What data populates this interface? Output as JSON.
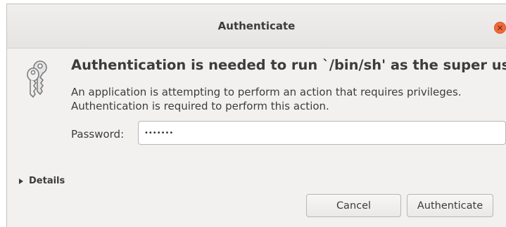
{
  "window": {
    "title": "Authenticate",
    "close_symbol": "✕",
    "icon": "keys-icon"
  },
  "dialog": {
    "heading": "Authentication is needed to run `/bin/sh' as the super user",
    "message": "An application is attempting to perform an action that requires privileges. Authentication is required to perform this action.",
    "password_label": "Password:",
    "password_value": "•••••••"
  },
  "details": {
    "label": "Details"
  },
  "buttons": {
    "cancel": "Cancel",
    "authenticate": "Authenticate"
  },
  "colors": {
    "close_button": "#f06a3a",
    "background": "#f2f1f0"
  }
}
